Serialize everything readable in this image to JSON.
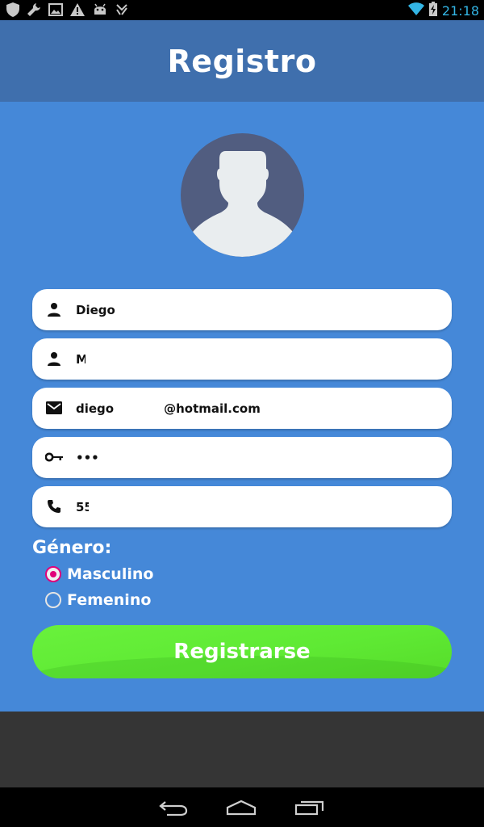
{
  "status_bar": {
    "time": "21:18",
    "left_icons": [
      "shield-icon",
      "wrench-icon",
      "image-icon",
      "warning-icon",
      "android-icon",
      "sign-icon"
    ],
    "right_icons": [
      "wifi-icon",
      "battery-charging-icon"
    ]
  },
  "header": {
    "title": "Registro"
  },
  "form": {
    "first_name": {
      "value": "Diego",
      "icon": "person-icon"
    },
    "last_name": {
      "value": "M",
      "icon": "person-icon"
    },
    "email": {
      "value_prefix": "diego",
      "value_suffix": "@hotmail.com",
      "icon": "mail-icon"
    },
    "password": {
      "value": "•••",
      "icon": "key-icon"
    },
    "phone": {
      "value": "55",
      "icon": "phone-icon"
    }
  },
  "gender": {
    "label": "Género:",
    "options": [
      {
        "label": "Masculino",
        "checked": true
      },
      {
        "label": "Femenino",
        "checked": false
      }
    ]
  },
  "submit": {
    "label": "Registrarse"
  },
  "nav_bar": {
    "buttons": [
      "back-icon",
      "home-icon",
      "recents-icon"
    ]
  },
  "colors": {
    "header": "#3f6fad",
    "background": "#4588d8",
    "button": "#62ec36",
    "radio_accent": "#e0007a",
    "avatar_bg": "#515d80"
  }
}
